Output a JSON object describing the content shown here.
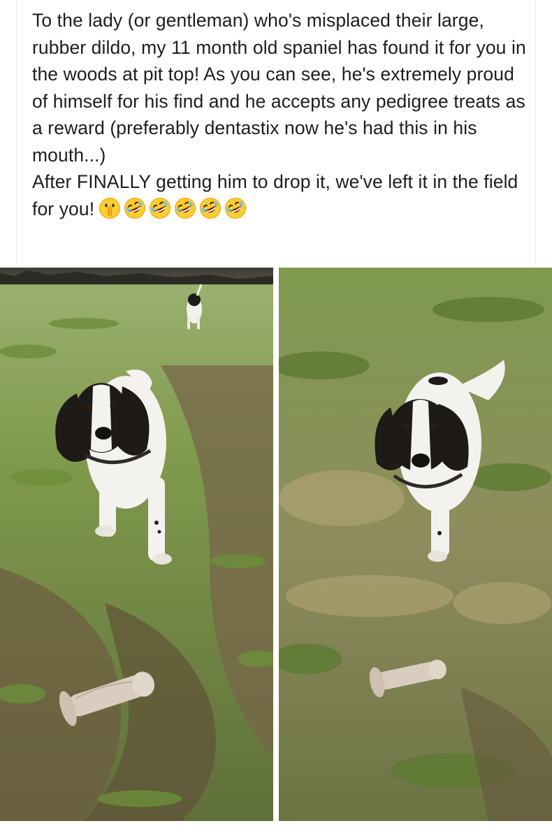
{
  "post": {
    "text_lines": [
      "To the lady (or gentleman) who's misplaced their large, rubber dildo, my 11 month old spaniel has found it for you in the woods at pit top! As you can see, he's extremely proud of himself for his find and he accepts any pedigree treats as a reward (preferably dentastix now he's had this in his mouth...)",
      "After FINALLY getting him to drop it, we've left it in the field for you!"
    ],
    "emojis": [
      "shushing-face",
      "rolling-on-the-floor-laughing",
      "rolling-on-the-floor-laughing",
      "rolling-on-the-floor-laughing",
      "rolling-on-the-floor-laughing",
      "rolling-on-the-floor-laughing"
    ]
  },
  "photos": [
    {
      "subject": "spaniel-with-toy-left"
    },
    {
      "subject": "spaniel-with-toy-right"
    }
  ],
  "colors": {
    "text": "#1c1e21",
    "grass_light": "#8ea65a",
    "grass_dark": "#5d7a33",
    "mud": "#6b5a45",
    "dog_white": "#f4f2ee",
    "dog_black": "#1d1a18"
  }
}
